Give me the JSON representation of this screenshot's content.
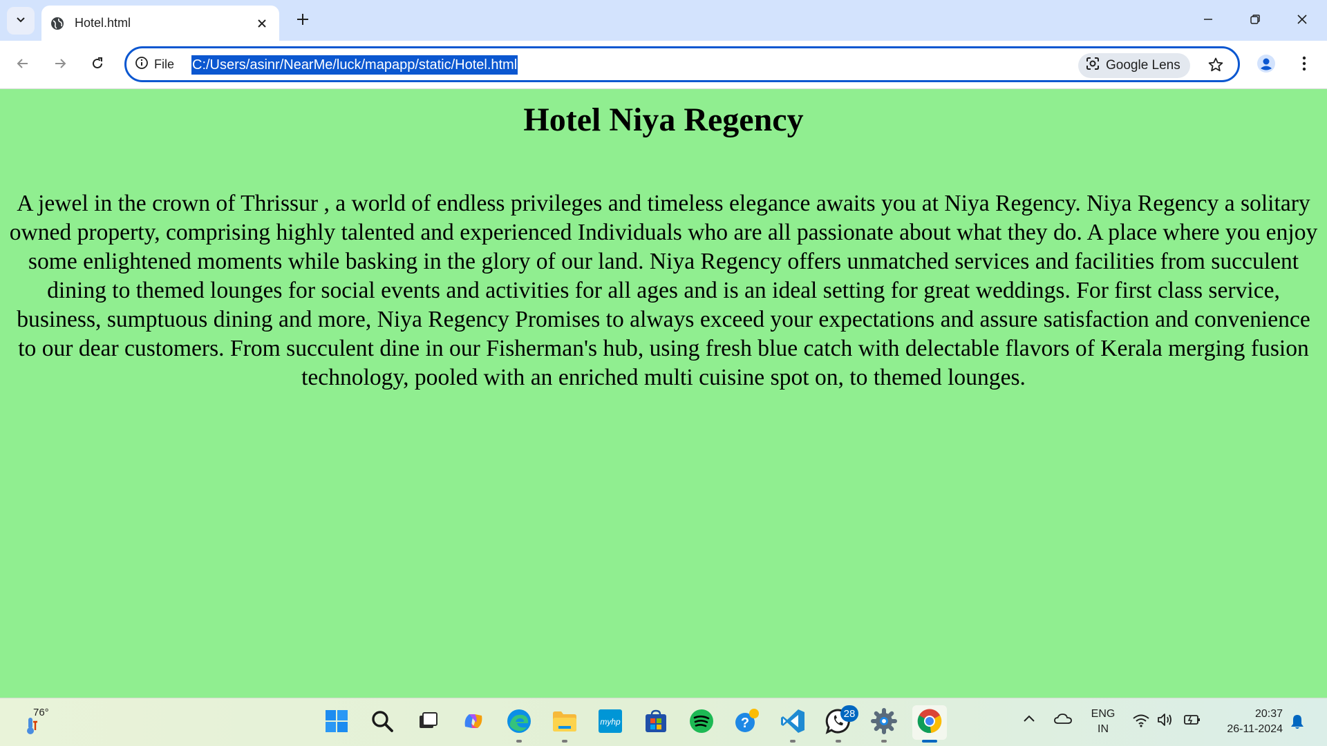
{
  "browser": {
    "tab": {
      "title": "Hotel.html"
    },
    "omnibox": {
      "site_info_label": "File",
      "url": "C:/Users/asinr/NearMe/luck/mapapp/static/Hotel.html",
      "lens_label": "Google Lens"
    }
  },
  "page": {
    "heading": "Hotel Niya Regency",
    "paragraph": "A jewel in the crown of Thrissur , a world of endless privileges and timeless elegance awaits you at Niya Regency. Niya Regency a solitary owned property, comprising highly talented and experienced Individuals who are all passionate about what they do. A place where you enjoy some enlightened moments while basking in the glory of our land. Niya Regency offers unmatched services and facilities from succulent dining to themed lounges for social events and activities for all ages and is an ideal setting for great weddings. For first class service, business, sumptuous dining and more, Niya Regency Promises to always exceed your expectations and assure satisfaction and convenience to our dear customers. From succulent dine in our Fisherman's hub, using fresh blue catch with delectable flavors of Kerala merging fusion technology, pooled with an enriched multi cuisine spot on, to themed lounges.",
    "background_color": "#90ee90"
  },
  "taskbar": {
    "weather_temp": "76°",
    "whatsapp_badge": "28",
    "language_line1": "ENG",
    "language_line2": "IN",
    "time": "20:37",
    "date": "26-11-2024",
    "apps": [
      "start-icon",
      "search-icon",
      "task-view-icon",
      "copilot-icon",
      "edge-icon",
      "file-explorer-icon",
      "myhp-icon",
      "microsoft-store-icon",
      "spotify-icon",
      "help-icon",
      "vscode-icon",
      "whatsapp-icon",
      "settings-icon",
      "chrome-icon"
    ]
  }
}
